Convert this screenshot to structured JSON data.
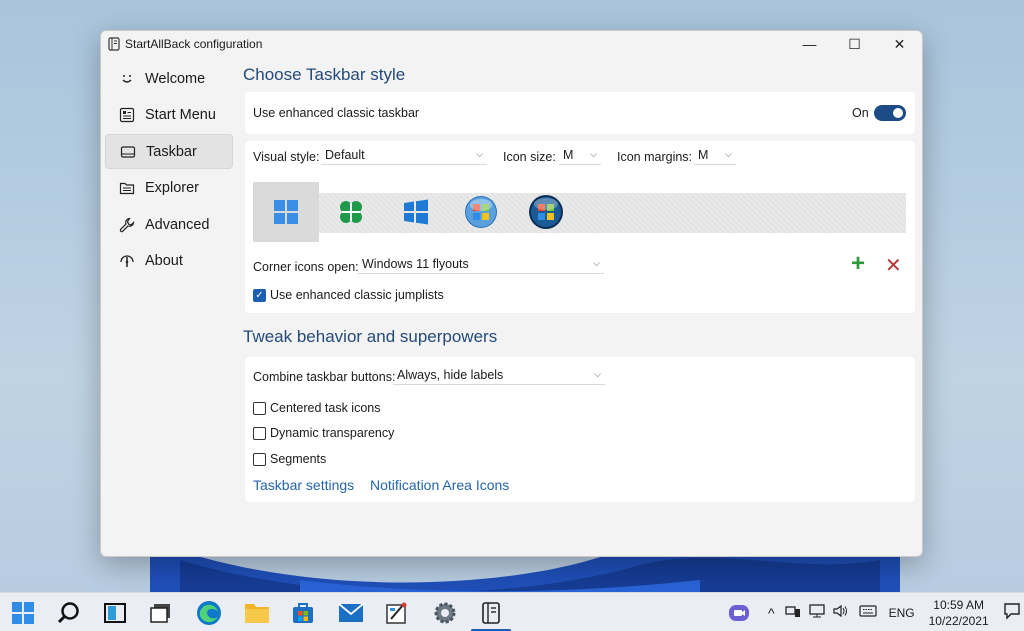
{
  "window": {
    "title": "StartAllBack configuration",
    "minimize": "—",
    "maximize": "☐",
    "close": "✕"
  },
  "sidebar": {
    "items": [
      {
        "label": "Welcome",
        "icon": "smile-icon"
      },
      {
        "label": "Start Menu",
        "icon": "start-menu-icon"
      },
      {
        "label": "Taskbar",
        "icon": "taskbar-icon",
        "active": true
      },
      {
        "label": "Explorer",
        "icon": "explorer-icon"
      },
      {
        "label": "Advanced",
        "icon": "wrench-icon"
      },
      {
        "label": "About",
        "icon": "about-icon"
      }
    ]
  },
  "main": {
    "section1_title": "Choose Taskbar style",
    "enhanced_taskbar": {
      "label": "Use enhanced classic taskbar",
      "state_label": "On",
      "on": true
    },
    "visual_style": {
      "label": "Visual style:",
      "value": "Default"
    },
    "icon_size": {
      "label": "Icon size:",
      "value": "M"
    },
    "icon_margins": {
      "label": "Icon margins:",
      "value": "M"
    },
    "style_options": [
      "windows11-logo",
      "clover-logo",
      "windows10-logo",
      "windows7-orb",
      "windows-vista-orb"
    ],
    "corner_icons": {
      "label": "Corner icons open:",
      "value": "Windows 11 flyouts"
    },
    "add_symbol": "+",
    "remove_symbol": "✕",
    "jumplists": {
      "label": "Use enhanced classic jumplists",
      "checked": true
    },
    "section2_title": "Tweak behavior and superpowers",
    "combine": {
      "label": "Combine taskbar buttons:",
      "value": "Always, hide labels"
    },
    "checkboxes": [
      {
        "label": "Centered task icons",
        "checked": false
      },
      {
        "label": "Dynamic transparency",
        "checked": false
      },
      {
        "label": "Segments",
        "checked": false
      }
    ],
    "links": {
      "taskbar_settings": "Taskbar settings",
      "notification_icons": "Notification Area Icons"
    }
  },
  "taskbar": {
    "apps": [
      "windows-start-icon",
      "search-icon",
      "task-view-icon",
      "desktop-icon",
      "edge-icon",
      "file-explorer-icon",
      "store-icon",
      "mail-icon",
      "paint-icon",
      "settings-icon",
      "startallback-icon"
    ],
    "tray": {
      "chevron": "^",
      "language": "ENG",
      "time": "10:59 AM",
      "date": "10/22/2021"
    }
  },
  "colors": {
    "accent": "#1d4b86",
    "heading": "#234a7a",
    "link": "#2565ad",
    "add": "#2e9a3a",
    "remove": "#b03a3a"
  }
}
